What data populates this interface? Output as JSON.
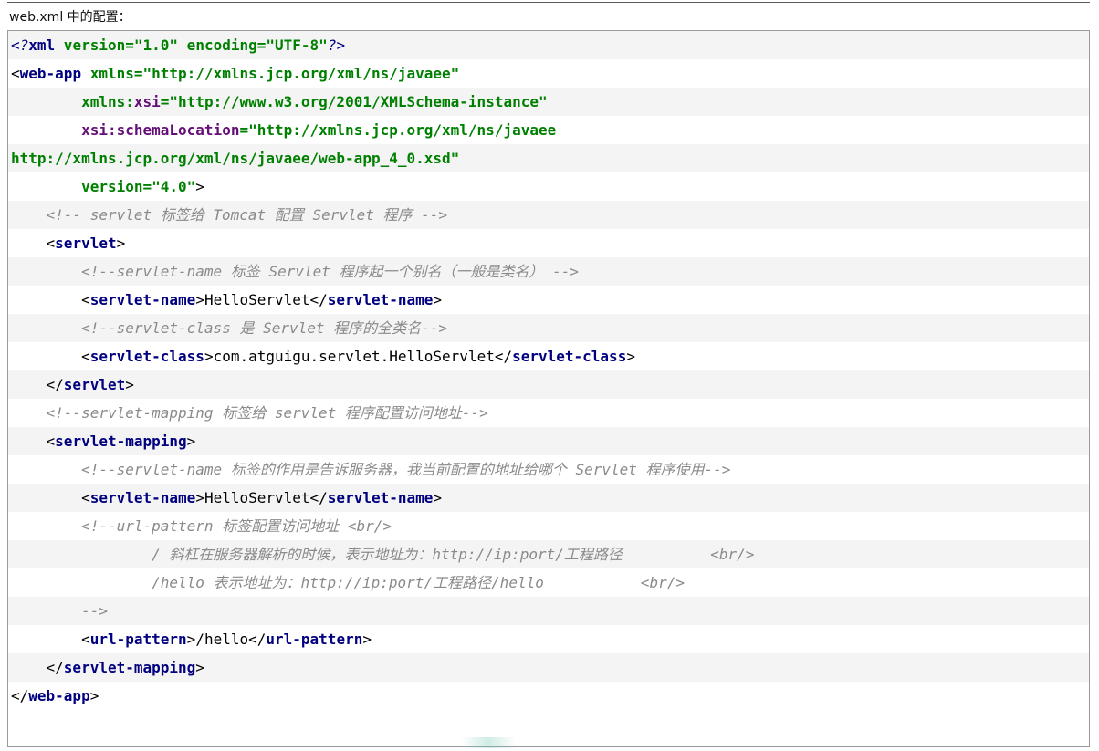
{
  "heading": "web.xml 中的配置：",
  "lines": {
    "l0": {
      "p1": "<?",
      "p2": "xml",
      "p3": " version=",
      "p4": "\"1.0\"",
      "p5": " encoding=",
      "p6": "\"UTF-8\"",
      "p7": "?>"
    },
    "l1": {
      "p1": "<",
      "p2": "web-app",
      "p3": " xmlns=",
      "p4": "\"http://xmlns.jcp.org/xml/ns/javaee\""
    },
    "l2": {
      "indent": "        ",
      "p1": "xmlns:",
      "p2": "xsi",
      "p3": "=",
      "p4": "\"http://www.w3.org/2001/XMLSchema-instance\""
    },
    "l3": {
      "indent": "        ",
      "p1": "xsi:",
      "p2": "schemaLocation",
      "p3": "=",
      "p4": "\"http://xmlns.jcp.org/xml/ns/javaee"
    },
    "l4": {
      "p1": "http://xmlns.jcp.org/xml/ns/javaee/web-app_4_0.xsd\""
    },
    "l5": {
      "indent": "        ",
      "p1": "version=",
      "p2": "\"4.0\"",
      "p3": ">"
    },
    "l6": {
      "indent": "    ",
      "p1": "<!-- servlet 标签给 Tomcat 配置 Servlet 程序 -->"
    },
    "l7": {
      "indent": "    ",
      "p1": "<",
      "p2": "servlet",
      "p3": ">"
    },
    "l8": {
      "indent": "        ",
      "p1": "<!--servlet-name 标签 Servlet 程序起一个别名（一般是类名） -->"
    },
    "l9": {
      "indent": "        ",
      "p1": "<",
      "p2": "servlet-name",
      "p3": ">",
      "p4": "HelloServlet",
      "p5": "</",
      "p6": "servlet-name",
      "p7": ">"
    },
    "l10": {
      "indent": "        ",
      "p1": "<!--servlet-class 是 Servlet 程序的全类名-->"
    },
    "l11": {
      "indent": "        ",
      "p1": "<",
      "p2": "servlet-class",
      "p3": ">",
      "p4": "com.atguigu.servlet.HelloServlet",
      "p5": "</",
      "p6": "servlet-class",
      "p7": ">"
    },
    "l12": {
      "indent": "    ",
      "p1": "</",
      "p2": "servlet",
      "p3": ">"
    },
    "l13": {
      "indent": "    ",
      "p1": "<!--servlet-mapping 标签给 servlet 程序配置访问地址-->"
    },
    "l14": {
      "indent": "    ",
      "p1": "<",
      "p2": "servlet-mapping",
      "p3": ">"
    },
    "l15": {
      "indent": "        ",
      "p1": "<!--servlet-name 标签的作用是告诉服务器，我当前配置的地址给哪个 Servlet 程序使用-->"
    },
    "l16": {
      "indent": "        ",
      "p1": "<",
      "p2": "servlet-name",
      "p3": ">",
      "p4": "HelloServlet",
      "p5": "</",
      "p6": "servlet-name",
      "p7": ">"
    },
    "l17": {
      "indent": "        ",
      "p1": "<!--url-pattern 标签配置访问地址 <br/>"
    },
    "l18": {
      "indent": "                ",
      "p1": "/ 斜杠在服务器解析的时候，表示地址为：http://ip:port/工程路径          <br/>"
    },
    "l19": {
      "indent": "                ",
      "p1": "/hello 表示地址为：http://ip:port/工程路径/hello           <br/>"
    },
    "l20": {
      "indent": "        ",
      "p1": "-->"
    },
    "l21": {
      "indent": "        ",
      "p1": "<",
      "p2": "url-pattern",
      "p3": ">",
      "p4": "/hello",
      "p5": "</",
      "p6": "url-pattern",
      "p7": ">"
    },
    "l22": {
      "indent": "    ",
      "p1": "</",
      "p2": "servlet-mapping",
      "p3": ">"
    },
    "l23": {
      "p1": "</",
      "p2": "web-app",
      "p3": ">"
    }
  }
}
